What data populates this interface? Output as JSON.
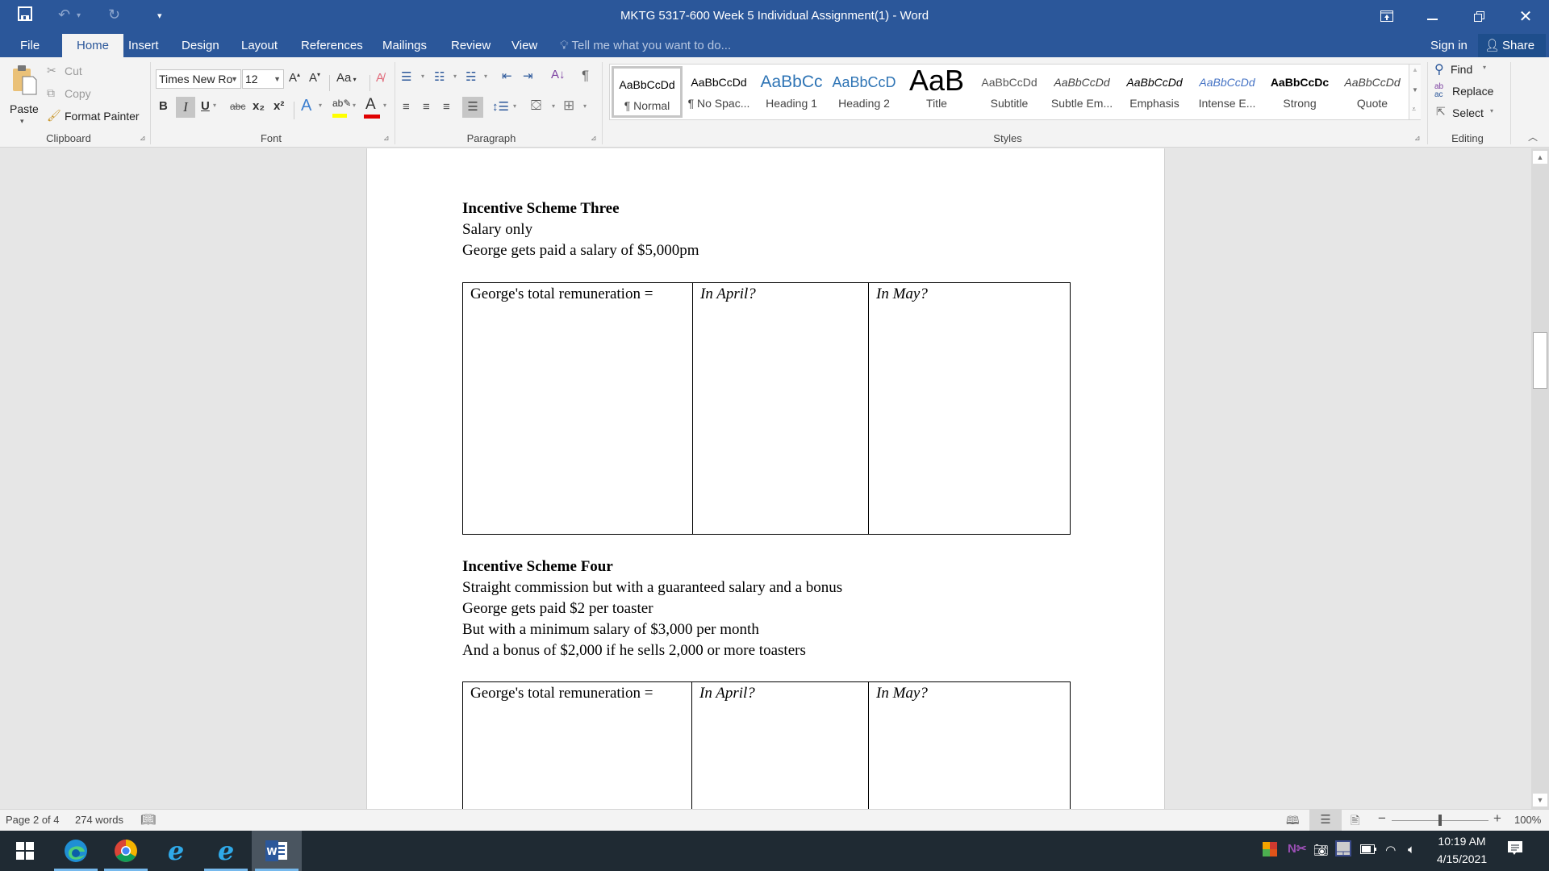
{
  "window": {
    "title": "MKTG 5317-600 Week 5 Individual Assignment(1) - Word",
    "controls": {
      "ribbon_display": "ribbon-display-options-icon",
      "minimize": "minimize-icon",
      "restore": "restore-icon",
      "close": "close-icon"
    }
  },
  "qat": {
    "save": "save-icon",
    "undo": "undo-icon",
    "redo": "redo-icon",
    "customize": "customize-qat-icon"
  },
  "tabs": [
    {
      "label": "File"
    },
    {
      "label": "Home",
      "active": true
    },
    {
      "label": "Insert"
    },
    {
      "label": "Design"
    },
    {
      "label": "Layout"
    },
    {
      "label": "References"
    },
    {
      "label": "Mailings"
    },
    {
      "label": "Review"
    },
    {
      "label": "View"
    }
  ],
  "tell_me": {
    "placeholder": "Tell me what you want to do..."
  },
  "account": {
    "sign_in": "Sign in",
    "share": "Share"
  },
  "ribbon": {
    "clipboard": {
      "label": "Clipboard",
      "paste": "Paste",
      "cut": "Cut",
      "copy": "Copy",
      "format_painter": "Format Painter"
    },
    "font": {
      "label": "Font",
      "font_name": "Times New Ro",
      "font_size": "12",
      "change_case": "Aa",
      "bold": "B",
      "italic": "I",
      "underline": "U",
      "strikethrough": "abc",
      "subscript": "x₂",
      "superscript": "x²",
      "highlight_color": "#ffff00",
      "font_color": "#e00000"
    },
    "paragraph": {
      "label": "Paragraph"
    },
    "styles": {
      "label": "Styles",
      "items": [
        {
          "preview": "AaBbCcDd",
          "name": "¶ Normal",
          "selected": true
        },
        {
          "preview": "AaBbCcDd",
          "name": "¶ No Spac..."
        },
        {
          "preview": "AaBbCc",
          "name": "Heading 1"
        },
        {
          "preview": "AaBbCcD",
          "name": "Heading 2"
        },
        {
          "preview": "AaB",
          "name": "Title"
        },
        {
          "preview": "AaBbCcDd",
          "name": "Subtitle"
        },
        {
          "preview": "AaBbCcDd",
          "name": "Subtle Em..."
        },
        {
          "preview": "AaBbCcDd",
          "name": "Emphasis"
        },
        {
          "preview": "AaBbCcDd",
          "name": "Intense E..."
        },
        {
          "preview": "AaBbCcDc",
          "name": "Strong"
        },
        {
          "preview": "AaBbCcDd",
          "name": "Quote"
        }
      ]
    },
    "editing": {
      "label": "Editing",
      "find": "Find",
      "replace": "Replace",
      "select": "Select"
    }
  },
  "document": {
    "sections": [
      {
        "heading": "Incentive Scheme Three",
        "lines": [
          "Salary only",
          "George gets paid a salary of $5,000pm"
        ],
        "table": {
          "cells": [
            "George's total remuneration =",
            "In April?",
            "In May?"
          ]
        }
      },
      {
        "heading": "Incentive Scheme Four",
        "lines": [
          "Straight commission but with a guaranteed salary and a bonus",
          "George gets paid $2 per toaster",
          "But with a minimum salary of $3,000 per month",
          "And a bonus of $2,000 if he sells 2,000 or more toasters"
        ],
        "table": {
          "cells": [
            "George's total remuneration =",
            "In April?",
            "In May?"
          ]
        }
      }
    ]
  },
  "statusbar": {
    "page": "Page 2 of 4",
    "words": "274 words",
    "zoom": "100%",
    "zoom_percent": 100
  },
  "taskbar": {
    "apps": [
      "Start",
      "Microsoft Edge",
      "Google Chrome",
      "Internet Explorer",
      "Internet Explorer",
      "Microsoft Word"
    ],
    "time": "10:19 AM",
    "date": "4/15/2021"
  }
}
